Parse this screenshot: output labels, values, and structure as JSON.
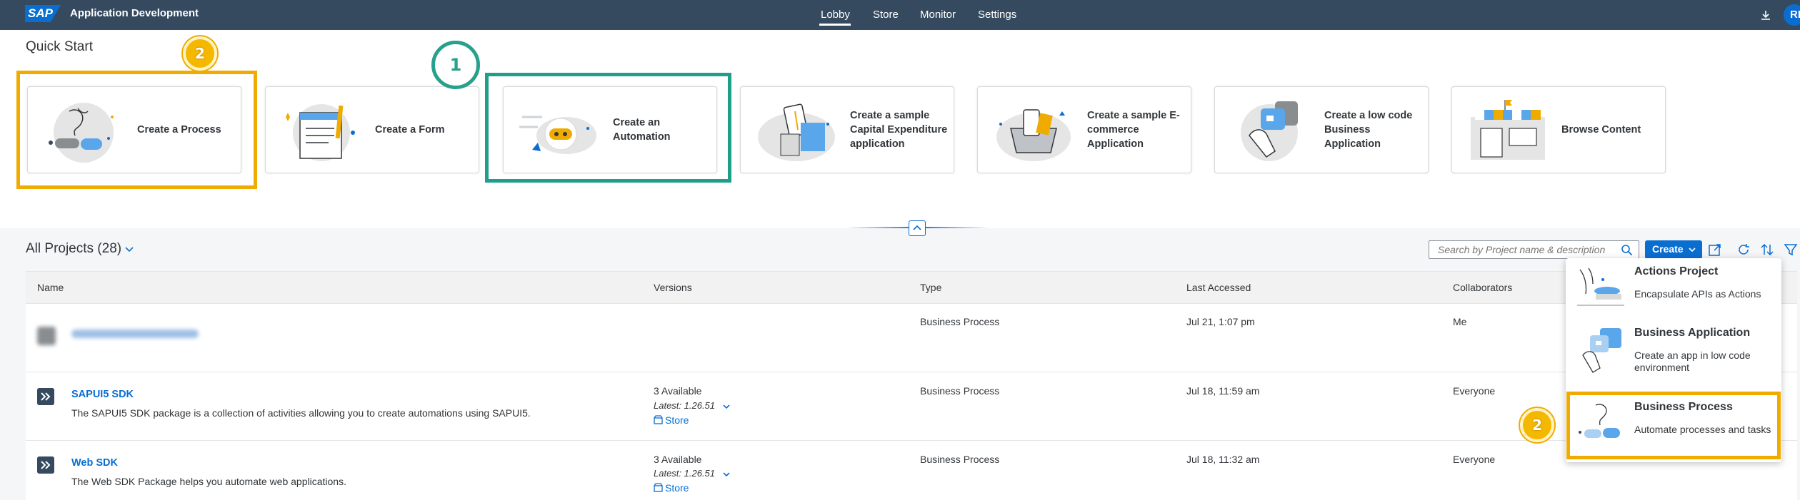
{
  "shell": {
    "logo": "SAP",
    "app_title": "Application Development",
    "nav": [
      "Lobby",
      "Store",
      "Monitor",
      "Settings"
    ],
    "active_nav": "Lobby",
    "avatar_initials": "RI"
  },
  "quick_start": {
    "title": "Quick Start",
    "tiles": [
      {
        "label": "Create a Process",
        "icon": "process-illustration-icon"
      },
      {
        "label": "Create a Form",
        "icon": "form-illustration-icon"
      },
      {
        "label": "Create an Automation",
        "icon": "automation-bot-icon"
      },
      {
        "label": "Create a sample Capital Expenditure application",
        "icon": "capex-illustration-icon"
      },
      {
        "label": "Create a sample E-commerce Application",
        "icon": "ecommerce-basket-icon"
      },
      {
        "label": "Create a low code Business Application",
        "icon": "business-app-illustration-icon"
      },
      {
        "label": "Browse Content",
        "icon": "storefront-icon"
      }
    ]
  },
  "annotations": {
    "badge_1": "1",
    "badge_2_top": "2",
    "badge_2_menu": "2"
  },
  "projects": {
    "title": "All Projects (28)",
    "search_placeholder": "Search by Project name & description",
    "create_label": "Create",
    "columns": [
      "Name",
      "Versions",
      "Type",
      "Last Accessed",
      "Collaborators"
    ],
    "rows": [
      {
        "name": "",
        "description": "",
        "versions": "",
        "latest": "",
        "store": "",
        "type": "Business Process",
        "last_accessed": "Jul 21, 1:07 pm",
        "collaborators": "Me"
      },
      {
        "name": "SAPUI5 SDK",
        "description": "The SAPUI5 SDK package is a collection of activities allowing you to create automations using SAPUI5.",
        "versions": "3 Available",
        "latest": "Latest: 1.26.51",
        "store": "Store",
        "type": "Business Process",
        "last_accessed": "Jul 18, 11:59 am",
        "collaborators": "Everyone"
      },
      {
        "name": "Web SDK",
        "description": "The Web SDK Package helps you automate web applications.",
        "versions": "3 Available",
        "latest": "Latest: 1.26.51",
        "store": "Store",
        "type": "Business Process",
        "last_accessed": "Jul 18, 11:32 am",
        "collaborators": "Everyone"
      }
    ]
  },
  "create_menu": {
    "items": [
      {
        "title": "Actions Project",
        "description": "Encapsulate APIs as Actions"
      },
      {
        "title": "Business Application",
        "description": "Create an app in low code environment"
      },
      {
        "title": "Business Process",
        "description": "Automate processes and tasks"
      }
    ]
  },
  "colors": {
    "shell": "#354a5f",
    "brand_blue": "#0a6ed1",
    "highlight_yellow": "#f0ab00",
    "highlight_teal": "#1f9e8a"
  }
}
